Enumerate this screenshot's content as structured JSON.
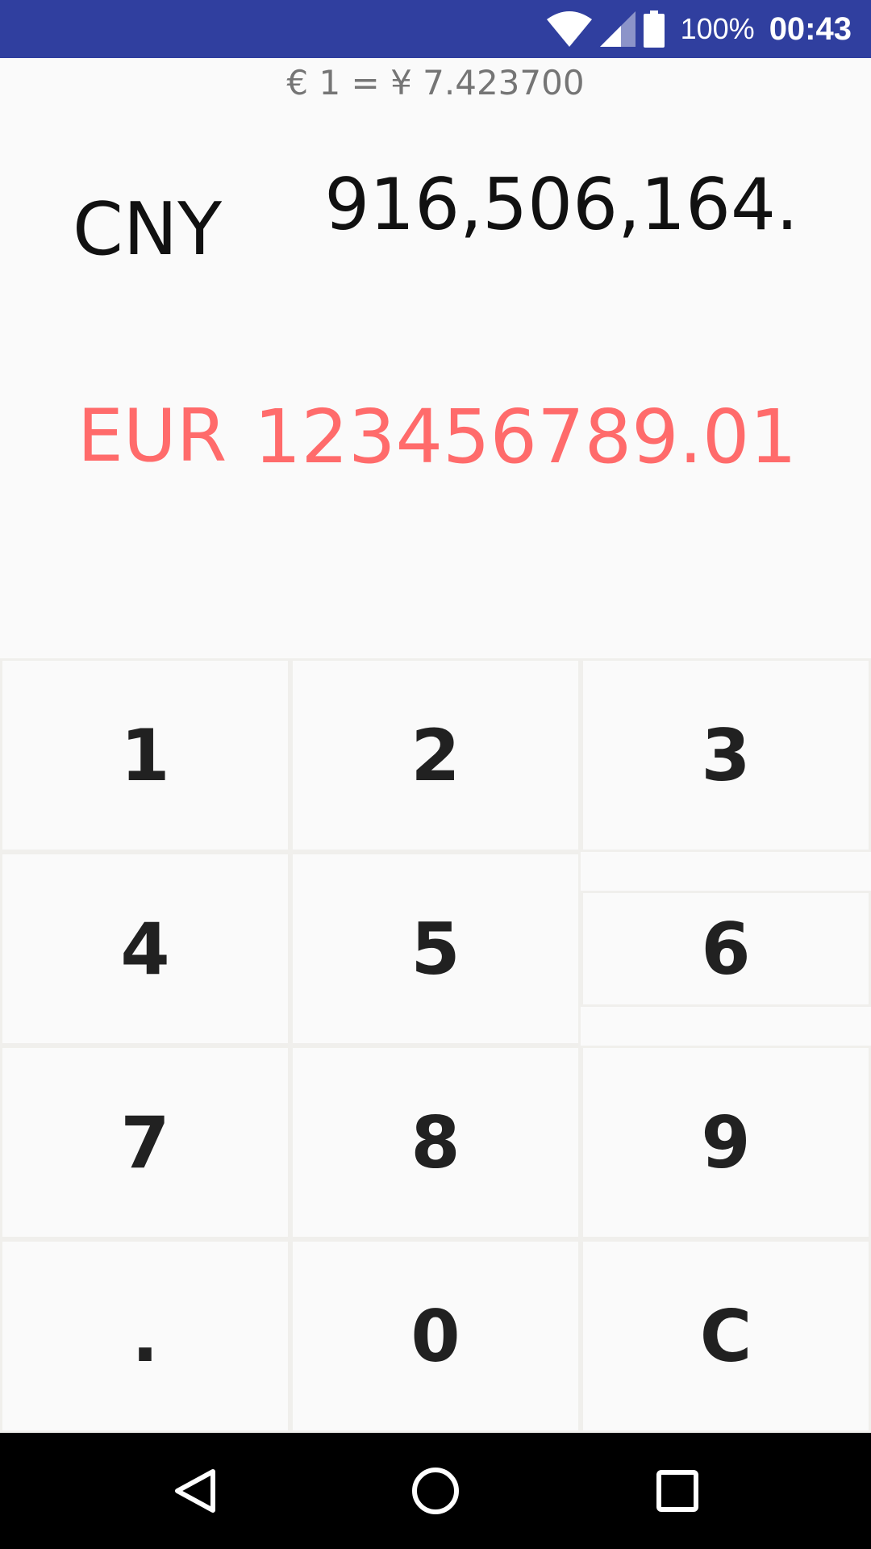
{
  "status_bar": {
    "battery_percent": "100%",
    "time": "00:43",
    "color": "#303f9f",
    "icons": [
      "wifi-icon",
      "signal-icon",
      "battery-icon"
    ]
  },
  "rate_text": "€ 1 = ¥ 7.423700",
  "rows": {
    "top": {
      "currency": "CNY",
      "amount": "916,506,164."
    },
    "bottom": {
      "currency": "EUR",
      "amount": "123456789.01",
      "color": "#ff6b6b"
    }
  },
  "keypad": {
    "keys": [
      "1",
      "2",
      "3",
      "4",
      "5",
      "6",
      "7",
      "8",
      "9",
      ".",
      "0",
      "C"
    ]
  },
  "nav_bar": {
    "icons": [
      "back-icon",
      "home-icon",
      "recents-icon"
    ]
  }
}
